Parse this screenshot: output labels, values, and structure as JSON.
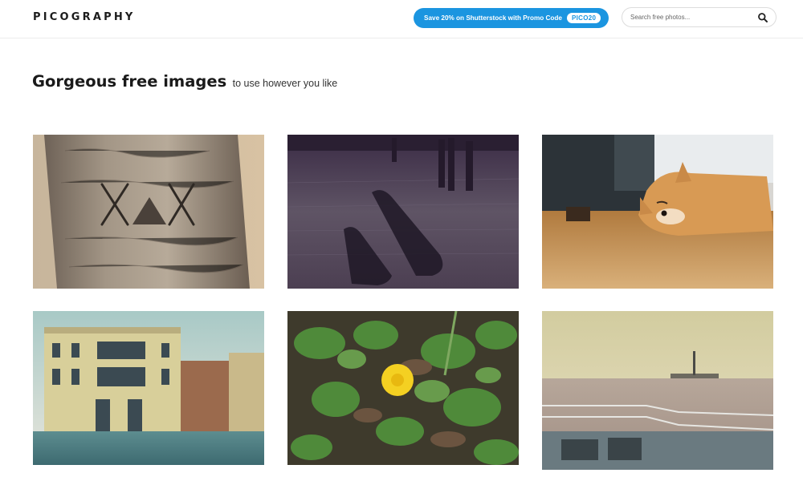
{
  "header": {
    "logo": "PICOGRAPHY",
    "promo": {
      "text": "Save 20% on Shutterstock with Promo Code",
      "code": "PICO20",
      "color": "#1b95e0"
    },
    "search": {
      "placeholder": "Search free photos...",
      "icon": "search-icon"
    }
  },
  "hero": {
    "headline_strong": "Gorgeous free images",
    "headline_rest": "to use however you like"
  },
  "photos": [
    {
      "name": "photo-tree-bark-carving",
      "subject": "carved tree trunk"
    },
    {
      "name": "photo-street-shadows",
      "subject": "shadows on a plaza"
    },
    {
      "name": "photo-shiba-dog",
      "subject": "dog resting on floor"
    },
    {
      "name": "photo-venice-palazzo",
      "subject": "building on a canal"
    },
    {
      "name": "photo-yellow-dandelion",
      "subject": "yellow flower among leaves"
    },
    {
      "name": "photo-ferry-liberty",
      "subject": "ferry deck with statue in distance"
    }
  ]
}
